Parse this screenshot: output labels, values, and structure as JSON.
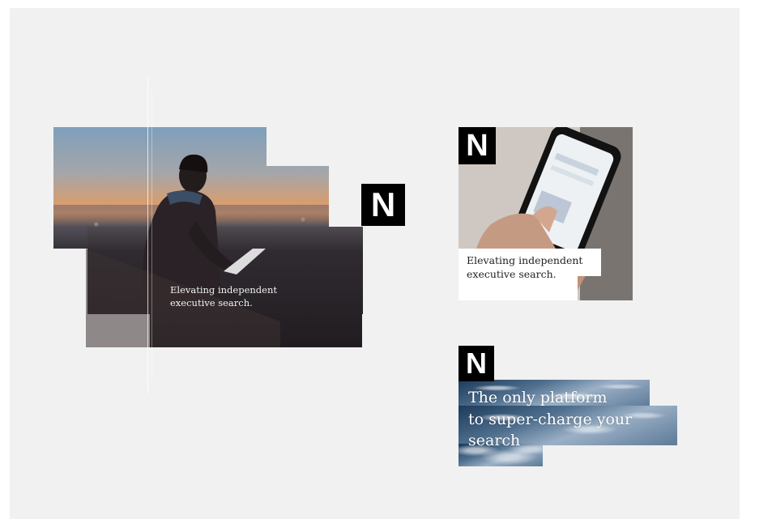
{
  "logo": {
    "letter": "N"
  },
  "left_card": {
    "caption_line1": "Elevating independent",
    "caption_line2": "executive search."
  },
  "phone_card": {
    "caption_line1": "Elevating independent",
    "caption_line2": "executive search."
  },
  "ocean_card": {
    "line1": "The only platform",
    "line2": "to super-charge your",
    "line3": "search"
  },
  "colors": {
    "background": "#f1f1f1",
    "logo_bg": "#000000",
    "logo_fg": "#ffffff"
  }
}
